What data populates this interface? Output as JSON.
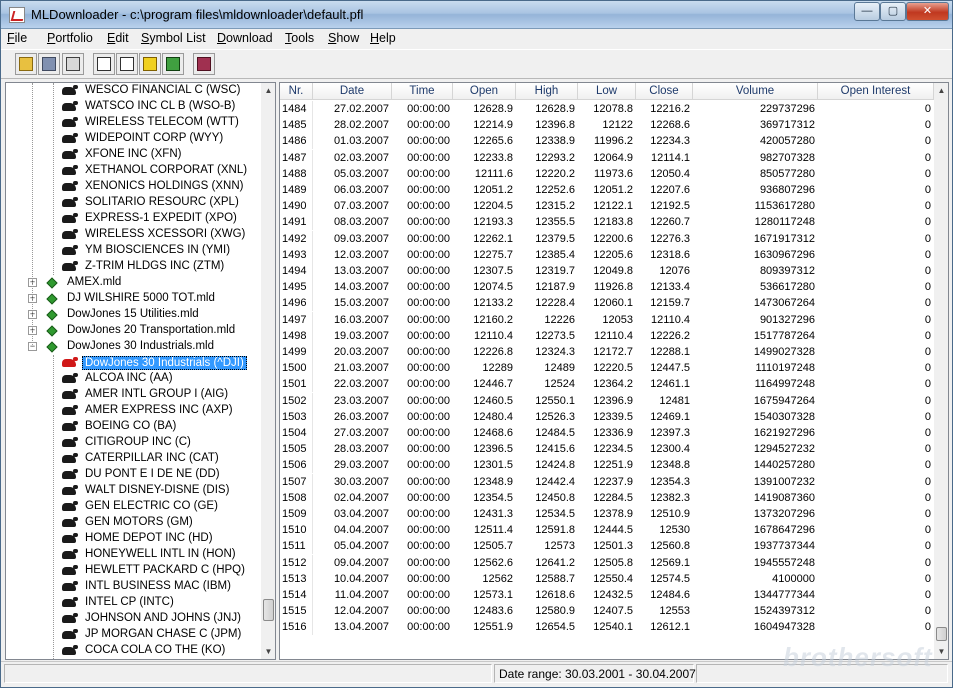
{
  "window": {
    "title": "MLDownloader - c:\\program files\\mldownloader\\default.pfl",
    "minimize": "—",
    "maximize": "▢",
    "close": "✕"
  },
  "menu": [
    {
      "label": "File",
      "u": "F",
      "rest": "ile"
    },
    {
      "label": "Portfolio",
      "u": "P",
      "rest": "ortfolio"
    },
    {
      "label": "Edit",
      "u": "E",
      "rest": "dit"
    },
    {
      "label": "Symbol List",
      "u": "S",
      "rest": "ymbol List"
    },
    {
      "label": "Download",
      "u": "D",
      "rest": "ownload"
    },
    {
      "label": "Tools",
      "u": "T",
      "rest": "ools"
    },
    {
      "label": "Show",
      "u": "S",
      "rest": "how"
    },
    {
      "label": "Help",
      "u": "H",
      "rest": "elp"
    }
  ],
  "toolbar": [
    "open-icon",
    "save-icon",
    "print-icon",
    "import-icon",
    "export-icon",
    "update-icon",
    "convert-icon",
    "book-icon"
  ],
  "tree": {
    "symbols_top": [
      "WESCO FINANCIAL C (WSC)",
      "WATSCO INC CL B (WSO-B)",
      "WIRELESS TELECOM (WTT)",
      "WIDEPOINT CORP (WYY)",
      "XFONE INC (XFN)",
      "XETHANOL CORPORAT (XNL)",
      "XENONICS HOLDINGS (XNN)",
      "SOLITARIO RESOURC (XPL)",
      "EXPRESS-1 EXPEDIT (XPO)",
      "WIRELESS XCESSORI (XWG)",
      "YM BIOSCIENCES IN (YMI)",
      "Z-TRIM HLDGS INC (ZTM)"
    ],
    "lists": [
      {
        "label": "AMEX.mld",
        "expanded": false
      },
      {
        "label": "DJ WILSHIRE 5000 TOT.mld",
        "expanded": false
      },
      {
        "label": "DowJones 15 Utilities.mld",
        "expanded": false
      },
      {
        "label": "DowJones 20 Transportation.mld",
        "expanded": false
      },
      {
        "label": "DowJones 30 Industrials.mld",
        "expanded": true
      }
    ],
    "selected": "DowJones 30 Industrials (^DJI)",
    "symbols_bottom": [
      "ALCOA INC (AA)",
      "AMER INTL GROUP I (AIG)",
      "AMER EXPRESS INC (AXP)",
      "BOEING CO (BA)",
      "CITIGROUP INC (C)",
      "CATERPILLAR INC (CAT)",
      "DU PONT E I DE NE (DD)",
      "WALT DISNEY-DISNE (DIS)",
      "GEN ELECTRIC CO (GE)",
      "GEN MOTORS (GM)",
      "HOME DEPOT INC (HD)",
      "HONEYWELL INTL IN (HON)",
      "HEWLETT PACKARD C (HPQ)",
      "INTL BUSINESS MAC (IBM)",
      "INTEL CP (INTC)",
      "JOHNSON AND JOHNS (JNJ)",
      "JP MORGAN CHASE C (JPM)",
      "COCA COLA CO THE (KO)"
    ]
  },
  "grid": {
    "columns": [
      "Nr.",
      "Date",
      "Time",
      "Open",
      "High",
      "Low",
      "Close",
      "Volume",
      "Open Interest"
    ],
    "rows": [
      [
        "1484",
        "27.02.2007",
        "00:00:00",
        "12628.9",
        "12628.9",
        "12078.8",
        "12216.2",
        "229737296",
        "0"
      ],
      [
        "1485",
        "28.02.2007",
        "00:00:00",
        "12214.9",
        "12396.8",
        "12122",
        "12268.6",
        "369717312",
        "0"
      ],
      [
        "1486",
        "01.03.2007",
        "00:00:00",
        "12265.6",
        "12338.9",
        "11996.2",
        "12234.3",
        "420057280",
        "0"
      ],
      [
        "1487",
        "02.03.2007",
        "00:00:00",
        "12233.8",
        "12293.2",
        "12064.9",
        "12114.1",
        "982707328",
        "0"
      ],
      [
        "1488",
        "05.03.2007",
        "00:00:00",
        "12111.6",
        "12220.2",
        "11973.6",
        "12050.4",
        "850577280",
        "0"
      ],
      [
        "1489",
        "06.03.2007",
        "00:00:00",
        "12051.2",
        "12252.6",
        "12051.2",
        "12207.6",
        "936807296",
        "0"
      ],
      [
        "1490",
        "07.03.2007",
        "00:00:00",
        "12204.5",
        "12315.2",
        "12122.1",
        "12192.5",
        "1153617280",
        "0"
      ],
      [
        "1491",
        "08.03.2007",
        "00:00:00",
        "12193.3",
        "12355.5",
        "12183.8",
        "12260.7",
        "1280117248",
        "0"
      ],
      [
        "1492",
        "09.03.2007",
        "00:00:00",
        "12262.1",
        "12379.5",
        "12200.6",
        "12276.3",
        "1671917312",
        "0"
      ],
      [
        "1493",
        "12.03.2007",
        "00:00:00",
        "12275.7",
        "12385.4",
        "12205.6",
        "12318.6",
        "1630967296",
        "0"
      ],
      [
        "1494",
        "13.03.2007",
        "00:00:00",
        "12307.5",
        "12319.7",
        "12049.8",
        "12076",
        "809397312",
        "0"
      ],
      [
        "1495",
        "14.03.2007",
        "00:00:00",
        "12074.5",
        "12187.9",
        "11926.8",
        "12133.4",
        "536617280",
        "0"
      ],
      [
        "1496",
        "15.03.2007",
        "00:00:00",
        "12133.2",
        "12228.4",
        "12060.1",
        "12159.7",
        "1473067264",
        "0"
      ],
      [
        "1497",
        "16.03.2007",
        "00:00:00",
        "12160.2",
        "12226",
        "12053",
        "12110.4",
        "901327296",
        "0"
      ],
      [
        "1498",
        "19.03.2007",
        "00:00:00",
        "12110.4",
        "12273.5",
        "12110.4",
        "12226.2",
        "1517787264",
        "0"
      ],
      [
        "1499",
        "20.03.2007",
        "00:00:00",
        "12226.8",
        "12324.3",
        "12172.7",
        "12288.1",
        "1499027328",
        "0"
      ],
      [
        "1500",
        "21.03.2007",
        "00:00:00",
        "12289",
        "12489",
        "12220.5",
        "12447.5",
        "1110197248",
        "0"
      ],
      [
        "1501",
        "22.03.2007",
        "00:00:00",
        "12446.7",
        "12524",
        "12364.2",
        "12461.1",
        "1164997248",
        "0"
      ],
      [
        "1502",
        "23.03.2007",
        "00:00:00",
        "12460.5",
        "12550.1",
        "12396.9",
        "12481",
        "1675947264",
        "0"
      ],
      [
        "1503",
        "26.03.2007",
        "00:00:00",
        "12480.4",
        "12526.3",
        "12339.5",
        "12469.1",
        "1540307328",
        "0"
      ],
      [
        "1504",
        "27.03.2007",
        "00:00:00",
        "12468.6",
        "12484.5",
        "12336.9",
        "12397.3",
        "1621927296",
        "0"
      ],
      [
        "1505",
        "28.03.2007",
        "00:00:00",
        "12396.5",
        "12415.6",
        "12234.5",
        "12300.4",
        "1294527232",
        "0"
      ],
      [
        "1506",
        "29.03.2007",
        "00:00:00",
        "12301.5",
        "12424.8",
        "12251.9",
        "12348.8",
        "1440257280",
        "0"
      ],
      [
        "1507",
        "30.03.2007",
        "00:00:00",
        "12348.9",
        "12442.4",
        "12237.9",
        "12354.3",
        "1391007232",
        "0"
      ],
      [
        "1508",
        "02.04.2007",
        "00:00:00",
        "12354.5",
        "12450.8",
        "12284.5",
        "12382.3",
        "1419087360",
        "0"
      ],
      [
        "1509",
        "03.04.2007",
        "00:00:00",
        "12431.3",
        "12534.5",
        "12378.9",
        "12510.9",
        "1373207296",
        "0"
      ],
      [
        "1510",
        "04.04.2007",
        "00:00:00",
        "12511.4",
        "12591.8",
        "12444.5",
        "12530",
        "1678647296",
        "0"
      ],
      [
        "1511",
        "05.04.2007",
        "00:00:00",
        "12505.7",
        "12573",
        "12501.3",
        "12560.8",
        "1937737344",
        "0"
      ],
      [
        "1512",
        "09.04.2007",
        "00:00:00",
        "12562.6",
        "12641.2",
        "12505.8",
        "12569.1",
        "1945557248",
        "0"
      ],
      [
        "1513",
        "10.04.2007",
        "00:00:00",
        "12562",
        "12588.7",
        "12550.4",
        "12574.5",
        "4100000",
        "0"
      ],
      [
        "1514",
        "11.04.2007",
        "00:00:00",
        "12573.1",
        "12618.6",
        "12432.5",
        "12484.6",
        "1344777344",
        "0"
      ],
      [
        "1515",
        "12.04.2007",
        "00:00:00",
        "12483.6",
        "12580.9",
        "12407.5",
        "12553",
        "1524397312",
        "0"
      ],
      [
        "1516",
        "13.04.2007",
        "00:00:00",
        "12551.9",
        "12654.5",
        "12540.1",
        "12612.1",
        "1604947328",
        "0"
      ]
    ]
  },
  "status": {
    "date_range": "Date range: 30.03.2001 - 30.04.2007"
  },
  "watermark": "brothersoft"
}
